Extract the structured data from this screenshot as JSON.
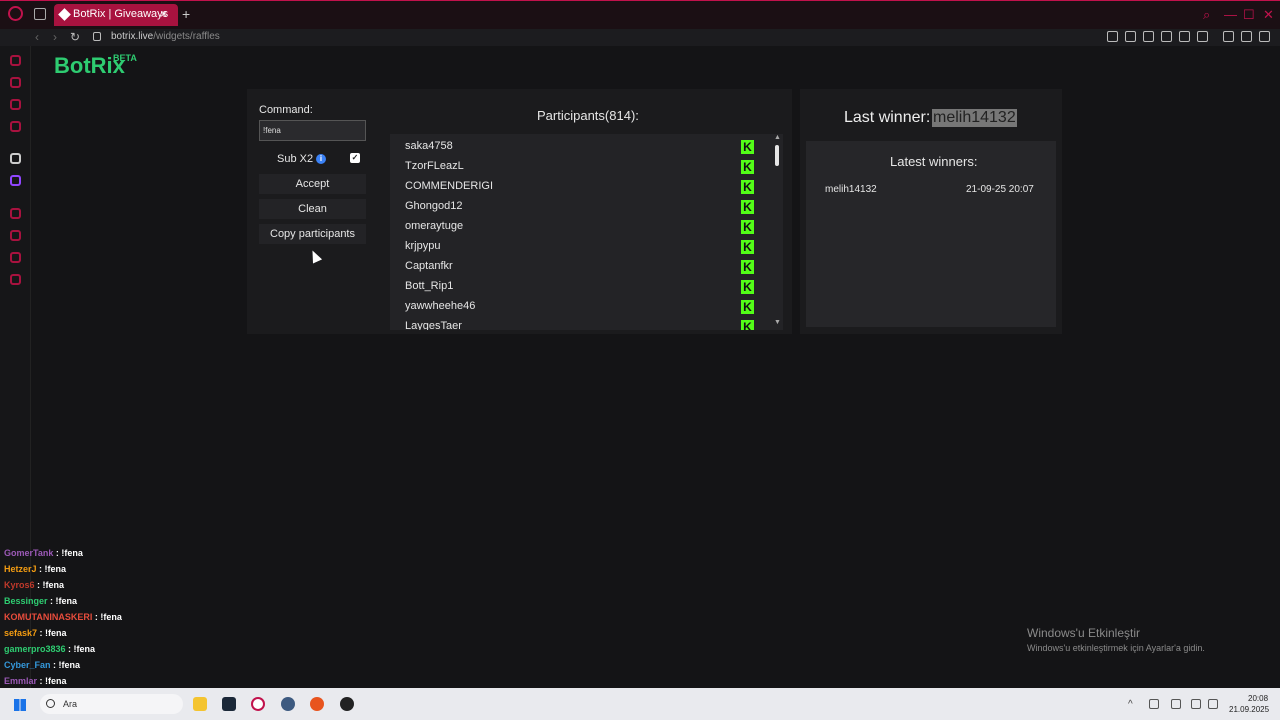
{
  "browser": {
    "tab_title": "BotRix | Giveaways",
    "new_tab_label": "+",
    "url_host": "botrix.live",
    "url_path": "/widgets/raffles"
  },
  "brand": {
    "name": "BotRix",
    "badge": "BETA"
  },
  "raffle": {
    "command_label": "Command:",
    "command_value": "!fena",
    "sub_label": "Sub X2",
    "sub_checked": "✓",
    "info_glyph": "i",
    "accept_label": "Accept",
    "clean_label": "Clean",
    "copy_label": "Copy participants"
  },
  "participants": {
    "title": "Participants(814):",
    "platform_icon": "kick-icon",
    "names": [
      "saka4758",
      "TzorFLeazL",
      "COMMENDERIGI",
      "Ghongod12",
      "omeraytuge",
      "krjpypu",
      "Captanfkr",
      "Bott_Rip1",
      "yawwheehe46",
      "LaygesTaer"
    ]
  },
  "winners": {
    "last_winner_label": "Last winner:",
    "last_winner_name": "melih14132",
    "latest_title": "Latest winners:",
    "items": [
      {
        "name": "melih14132",
        "date": "21-09-25 20:07"
      }
    ]
  },
  "chat": [
    {
      "user": "GomerTank",
      "sep": " : ",
      "msg": "!fena",
      "color": "#9b59b6"
    },
    {
      "user": "HetzerJ",
      "sep": " : ",
      "msg": "!fena",
      "color": "#f39c12"
    },
    {
      "user": "Kyros6",
      "sep": " : ",
      "msg": "!fena",
      "color": "#c0392b"
    },
    {
      "user": "Bessinger",
      "sep": " : ",
      "msg": "!fena",
      "color": "#2ecc71"
    },
    {
      "user": "KOMUTANINASKERI",
      "sep": " : ",
      "msg": "!fena",
      "color": "#e74c3c"
    },
    {
      "user": "sefask7",
      "sep": " : ",
      "msg": "!fena",
      "color": "#f39c12"
    },
    {
      "user": "gamerpro3836",
      "sep": " : ",
      "msg": "!fena",
      "color": "#2ecc71"
    },
    {
      "user": "Cyber_Fan",
      "sep": " : ",
      "msg": "!fena",
      "color": "#3498db"
    },
    {
      "user": "Emmlar",
      "sep": " : ",
      "msg": "!fena",
      "color": "#9b59b6"
    }
  ],
  "watermark": {
    "line1": "Windows'u Etkinleştir",
    "line2": "Windows'u etkinleştirmek için Ayarlar'a gidin."
  },
  "taskbar": {
    "search_placeholder": "Ara",
    "time": "20:08",
    "date": "21.09.2025"
  }
}
